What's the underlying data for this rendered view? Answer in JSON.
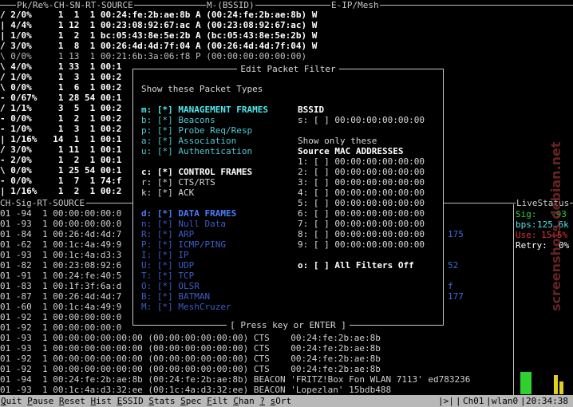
{
  "top_header": {
    "left": "Pk/Re%-CH-SN-RT-SOURCE",
    "mid": "M-(BSSID)",
    "right": "E-IP/Mesh"
  },
  "node_rows": [
    {
      "text": "/ 2/0%     1  1  1 00:24:fe:2b:ae:8b A (00:24:fe:2b:ae:8b) W",
      "bold": true
    },
    {
      "text": "| 4/4%     1 12  1 00:23:08:92:67:ac A (00:23:08:92:67:ac) W",
      "bold": true
    },
    {
      "text": "| 1/0%     1  2  1 bc:05:43:8e:5e:2b A (bc:05:43:8e:5e:2b) W",
      "bold": true
    },
    {
      "text": "/ 3/0%     1  8  1 00:26:4d:4d:7f:04 A (00:26:4d:4d:7f:04) W",
      "bold": true
    },
    {
      "text": "\\ 0/0%     1 13  1 00:21:6b:3a:06:f8 P (00:00:00:00:00:00)",
      "bold": false
    },
    {
      "text": "\\ 4/0%     1 33  1 00:1",
      "bold": true
    },
    {
      "text": "/ 1/0%     1  3  1 00:2",
      "bold": true
    },
    {
      "text": "\\ 0/0%     1  6  1 00:2",
      "bold": true
    },
    {
      "text": "- 0/67%    1 28 54 00:1",
      "bold": true
    },
    {
      "text": "/ 1/1%     3  5  1 00:2",
      "bold": true
    },
    {
      "text": "- 0/0%     1  2  1 00:2",
      "bold": true
    },
    {
      "text": "- 1/0%     1  3  1 00:2",
      "bold": true
    },
    {
      "text": "| 1/16%   14  1  1 00:1",
      "bold": true
    },
    {
      "text": "/ 3/0%     1 11  1 00:1",
      "bold": true
    },
    {
      "text": "- 2/0%     1  2  1 00:1",
      "bold": true
    },
    {
      "text": "\\ 0/0%     1 25 54 00:1",
      "bold": true
    },
    {
      "text": "- 0/0%     1  7  1 74:f",
      "bold": true
    },
    {
      "text": "| 1/16%    1  2  1 00:2",
      "bold": true
    }
  ],
  "packet_header": {
    "left": "CH-Sig-RT-SOURCE",
    "right": "LiveStatus"
  },
  "packet_rows": [
    {
      "text": "01 -94  1 00:00:00:00:0",
      "tail": ""
    },
    {
      "text": "01 -93  1 00:00:00:00:0",
      "tail": ""
    },
    {
      "text": "01 -84  1 00:26:4d:4d:7",
      "tail": "175"
    },
    {
      "text": "01 -62  1 00:1c:4a:49:9",
      "tail": ""
    },
    {
      "text": "01 -93  1 00:1c:4a:d3:3",
      "tail": ""
    },
    {
      "text": "01 -82  1 00:23:08:92:6",
      "tail": "52"
    },
    {
      "text": "01 -91  1 00:24:fe:40:5",
      "tail": ""
    },
    {
      "text": "01 -83  1 00:1f:3f:6a:d",
      "tail": "f"
    },
    {
      "text": "01 -87  1 00:26:4d:4d:7",
      "tail": "177"
    },
    {
      "text": "01 -60  1 00:1c:4a:49:9",
      "tail": ""
    },
    {
      "text": "01 -92  1 00:00:00:00:0",
      "tail": ""
    },
    {
      "text": "01 -92  1 00:00:00:00:0",
      "tail": ""
    },
    {
      "text": "01 -93  1 00:00:00:00:00:00 (00:00:00:00:00:00) CTS    00:24:fe:2b:ae:8b",
      "tail": ""
    },
    {
      "text": "01 -93  1 00:00:00:00:00:00 (00:00:00:00:00:00) CTS    00:24:fe:2b:ae:8b",
      "tail": ""
    },
    {
      "text": "01 -92  1 00:00:00:00:00:00 (00:00:00:00:00:00) CTS    00:24:fe:2b:ae:8b",
      "tail": ""
    },
    {
      "text": "01 -92  1 00:00:00:00:00:00 (00:00:00:00:00:00) CTS    00:24:fe:2b:ae:8b",
      "tail": ""
    },
    {
      "text": "01 -94  1 00:24:fe:2b:ae:8b (00:24:fe:2b:ae:8b) BEACON 'FRITZ!Box Fon WLAN 7113' ed783236",
      "tail": ""
    },
    {
      "text": "01 -93  1 00:1c:4a:d3:32:ee (00:1c:4a:d3:32:ee) BEACON 'Lopezlan' 15bdb488",
      "tail": ""
    }
  ],
  "live_status": {
    "sig_label": "Sig:",
    "sig_value": "-93",
    "bps_label": "bps:",
    "bps_value": "125.6k",
    "use_label": "Use:",
    "use_value": "15.5%",
    "retry_label": "Retry:",
    "retry_value": "0%",
    "colors": {
      "sig": "#32d232",
      "bps": "#4ee8ee",
      "use": "#e03030",
      "retry": "#ffffff"
    }
  },
  "dialog": {
    "title": "Edit Packet Filter",
    "subtitle": "Show these Packet Types",
    "footer": "[ Press key or ENTER ]",
    "left_lines": [
      {
        "text": "m: [*] MANAGEMENT FRAMES",
        "style": "mg"
      },
      {
        "text": "b: [*] Beacons",
        "style": "mgs"
      },
      {
        "text": "p: [*] Probe Req/Resp",
        "style": "mgs"
      },
      {
        "text": "a: [*] Association",
        "style": "mgs"
      },
      {
        "text": "u: [*] Authentication",
        "style": "mgs"
      },
      {
        "text": "",
        "style": ""
      },
      {
        "text": "c: [*] CONTROL FRAMES",
        "style": "b"
      },
      {
        "text": "r: [*] CTS/RTS",
        "style": ""
      },
      {
        "text": "k: [*] ACK",
        "style": ""
      },
      {
        "text": "",
        "style": ""
      },
      {
        "text": "d: [*] DATA FRAMES",
        "style": "df"
      },
      {
        "text": "n: [*] Null Data",
        "style": "dfs"
      },
      {
        "text": "R: [*] ARP",
        "style": "dfs"
      },
      {
        "text": "P: [*] ICMP/PING",
        "style": "dfs"
      },
      {
        "text": "I: [*] IP",
        "style": "dfs"
      },
      {
        "text": "U: [*] UDP",
        "style": "dfs"
      },
      {
        "text": "T: [*] TCP",
        "style": "dfs"
      },
      {
        "text": "O: [*] OLSR",
        "style": "dfs"
      },
      {
        "text": "B: [*] BATMAN",
        "style": "dfs"
      },
      {
        "text": "M: [*] MeshCruzer",
        "style": "dfs"
      }
    ],
    "right_lines": [
      {
        "text": "BSSID",
        "style": "b"
      },
      {
        "text": "s: [ ] 00:00:00:00:00:00",
        "style": ""
      },
      {
        "text": "",
        "style": ""
      },
      {
        "text": "Show only these",
        "style": ""
      },
      {
        "text": "Source MAC ADDRESSES",
        "style": "b"
      },
      {
        "text": "1: [ ] 00:00:00:00:00:00",
        "style": ""
      },
      {
        "text": "2: [ ] 00:00:00:00:00:00",
        "style": ""
      },
      {
        "text": "3: [ ] 00:00:00:00:00:00",
        "style": ""
      },
      {
        "text": "4: [ ] 00:00:00:00:00:00",
        "style": ""
      },
      {
        "text": "5: [ ] 00:00:00:00:00:00",
        "style": ""
      },
      {
        "text": "6: [ ] 00:00:00:00:00:00",
        "style": ""
      },
      {
        "text": "7: [ ] 00:00:00:00:00:00",
        "style": ""
      },
      {
        "text": "8: [ ] 00:00:00:00:00:00",
        "style": ""
      },
      {
        "text": "9: [ ] 00:00:00:00:00:00",
        "style": ""
      },
      {
        "text": "",
        "style": ""
      },
      {
        "text": "o: [ ] All Filters Off",
        "style": "b"
      }
    ]
  },
  "menu": [
    {
      "key": "Q",
      "rest": "uit"
    },
    {
      "key": "P",
      "rest": "ause"
    },
    {
      "key": "R",
      "rest": "eset"
    },
    {
      "key": "H",
      "rest": "ist"
    },
    {
      "key": "E",
      "rest": "SSID"
    },
    {
      "key": "S",
      "rest": "tats"
    },
    {
      "key": "S",
      "rest": "pec"
    },
    {
      "key": "F",
      "rest": "ilt"
    },
    {
      "key": "C",
      "rest": "han"
    },
    {
      "key": "?",
      "rest": ""
    },
    {
      "key": "s",
      "rest": "O",
      "extra": "rt"
    }
  ],
  "status_right": {
    "pause": "|>|",
    "channel": "Ch01",
    "iface": "wlan0",
    "clock": "20:34:38"
  },
  "watermark": "screenshots.debian.net"
}
